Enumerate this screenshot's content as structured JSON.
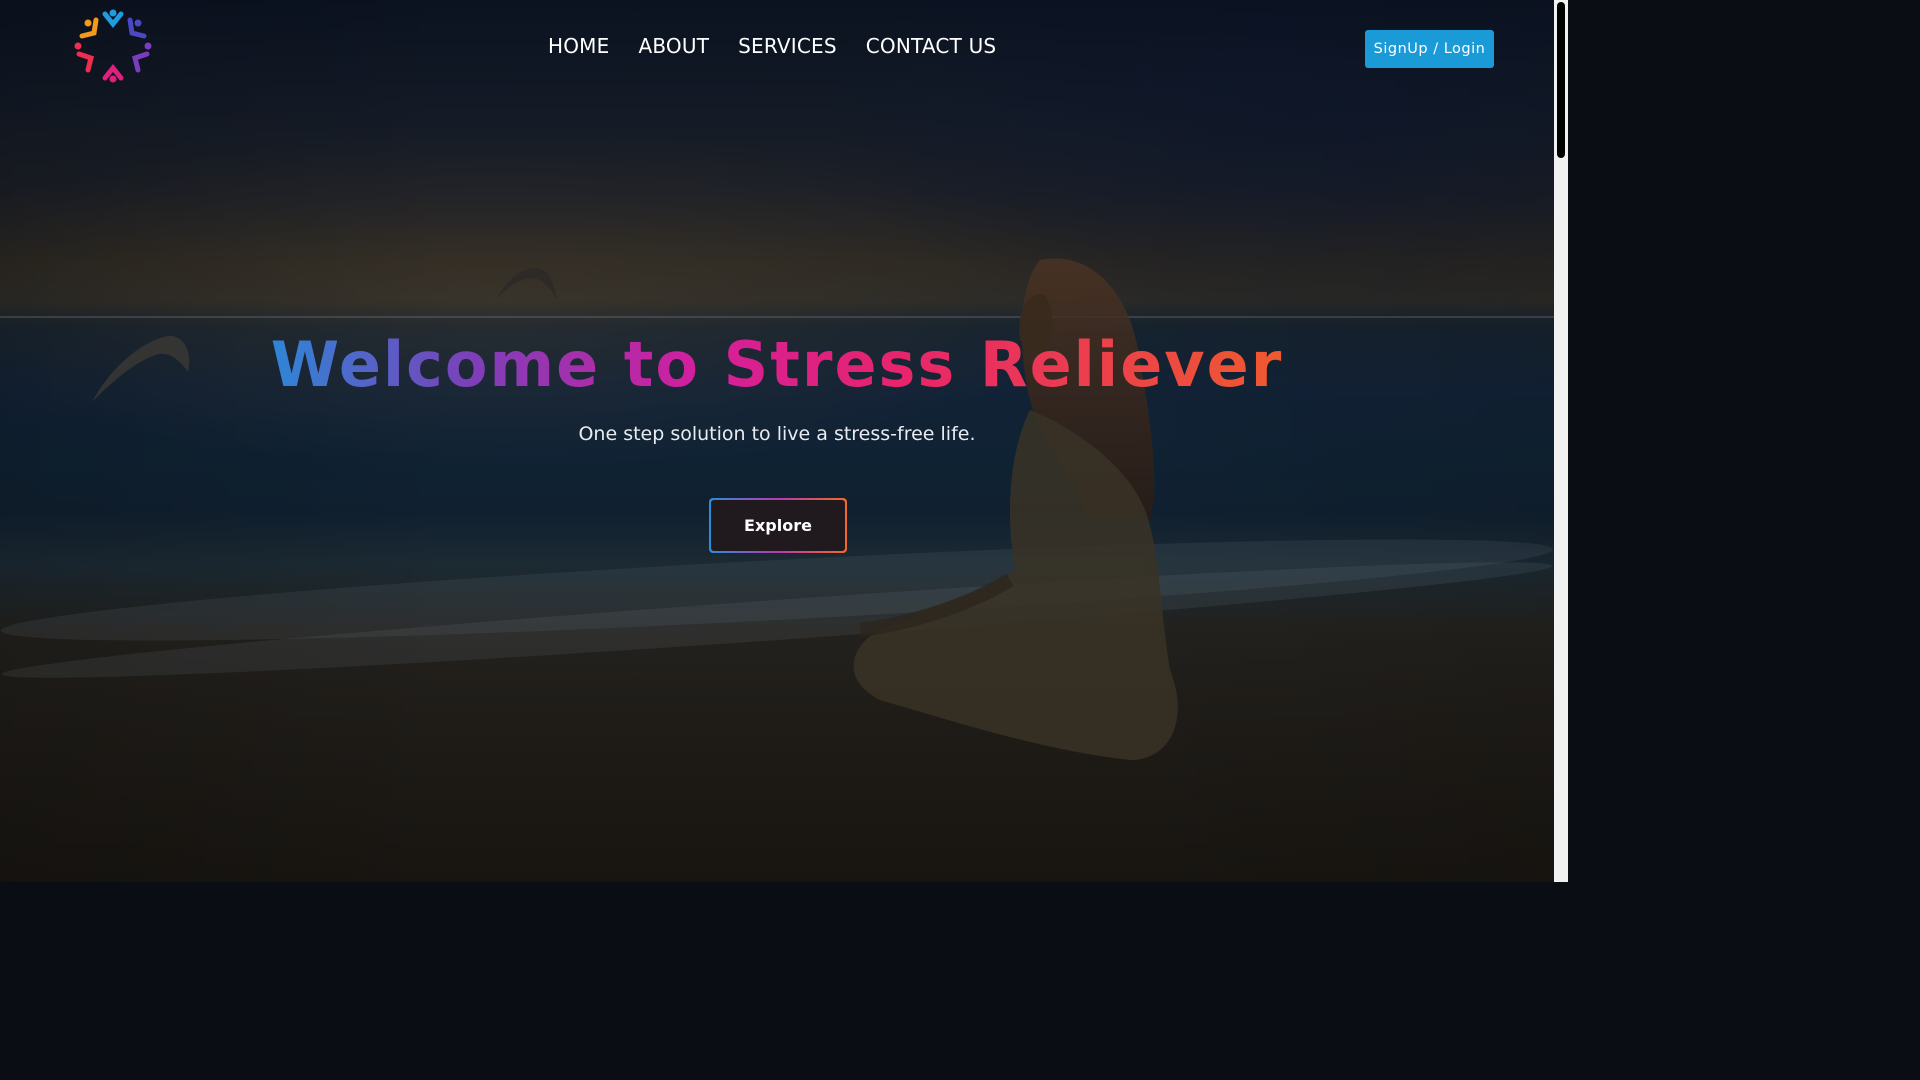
{
  "nav": {
    "items": [
      {
        "label": "HOME"
      },
      {
        "label": "ABOUT"
      },
      {
        "label": "SERVICES"
      },
      {
        "label": "CONTACT US"
      }
    ],
    "signup_label": "SignUp / Login"
  },
  "hero": {
    "title": "Welcome to Stress Reliever",
    "subtitle": "One step solution to live a stress-free life.",
    "explore_label": "Explore"
  },
  "colors": {
    "signup_button": "#1a9ad6",
    "title_gradient": [
      "#2e86d6",
      "#7d3fb8",
      "#d21f9e",
      "#e8246c",
      "#ef5a2e"
    ]
  },
  "icons": {
    "logo": "people-circle-logo-icon"
  }
}
